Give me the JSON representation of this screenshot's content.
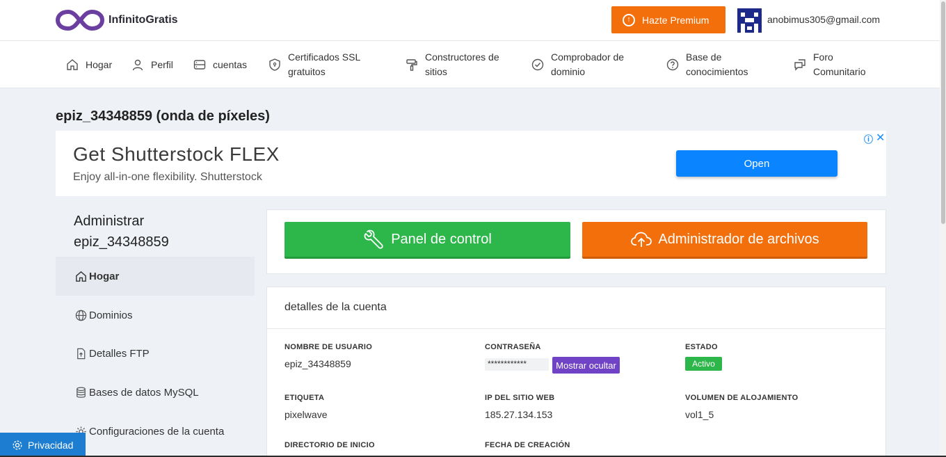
{
  "header": {
    "brand": "InfinitoGratis",
    "premium_label": "Hazte Premium",
    "email": "anobimus305@gmail.com"
  },
  "nav": {
    "items": [
      {
        "label": "Hogar",
        "icon": "home-icon"
      },
      {
        "label": "Perfil",
        "icon": "user-icon"
      },
      {
        "label": "cuentas",
        "icon": "server-icon"
      },
      {
        "label": "Certificados SSL gratuitos",
        "icon": "shield-icon"
      },
      {
        "label": "Constructores de sitios",
        "icon": "paint-roller-icon"
      },
      {
        "label": "Comprobador de dominio",
        "icon": "check-circle-icon"
      },
      {
        "label": "Base de conocimientos",
        "icon": "help-circle-icon"
      },
      {
        "label": "Foro Comunitario",
        "icon": "chat-icon"
      }
    ]
  },
  "page_title": "epiz_34348859 (onda de píxeles)",
  "ad": {
    "title": "Get Shutterstock FLEX",
    "subtitle": "Enjoy all-in-one flexibility. Shutterstock",
    "button": "Open",
    "info": "ⓘ",
    "close": "✕"
  },
  "sidebar": {
    "title_line1": "Administrar",
    "title_line2": "epiz_34348859",
    "items": [
      {
        "label": "Hogar",
        "icon": "home-icon",
        "active": true
      },
      {
        "label": "Dominios",
        "icon": "globe-icon"
      },
      {
        "label": "Detalles FTP",
        "icon": "file-upload-icon"
      },
      {
        "label": "Bases de datos MySQL",
        "icon": "database-icon"
      },
      {
        "label": "Configuraciones de la cuenta",
        "icon": "gear-icon"
      }
    ]
  },
  "actions": {
    "control_panel": "Panel de control",
    "file_manager": "Administrador de archivos"
  },
  "details": {
    "heading": "detalles de la cuenta",
    "username_label": "NOMBRE DE USUARIO",
    "username": "epiz_34348859",
    "password_label": "CONTRASEÑA",
    "password_masked": "************",
    "show_hide": "Mostrar ocultar",
    "status_label": "ESTADO",
    "status": "Activo",
    "tag_label": "ETIQUETA",
    "tag": "pixelwave",
    "ip_label": "IP DEL SITIO WEB",
    "ip": "185.27.134.153",
    "volume_label": "VOLUMEN DE ALOJAMIENTO",
    "volume": "vol1_5",
    "home_dir_label": "DIRECTORIO DE INICIO",
    "created_label": "FECHA DE CREACIÓN"
  },
  "privacy": "Privacidad",
  "colors": {
    "orange": "#f26f0c",
    "green": "#2db74a",
    "purple": "#7043c6",
    "ad_blue": "#0a84ff",
    "logo_purple": "#6b3fa0"
  }
}
